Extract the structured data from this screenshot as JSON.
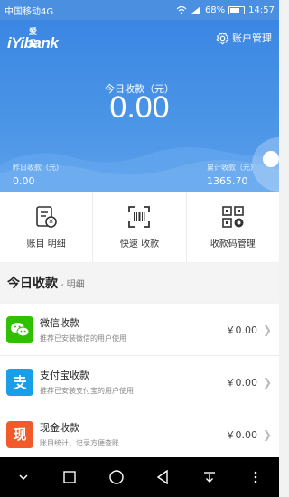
{
  "status": {
    "carrier": "中国移动4G",
    "battery": "68%",
    "time": "14:57"
  },
  "header": {
    "logo_cn": "爱品",
    "logo_en": "iYibank",
    "account_mgmt": "账户管理",
    "today_label": "今日收款（元）",
    "today_amount": "0.00",
    "yesterday_label": "昨日收款（元）",
    "yesterday_amount": "0.00",
    "total_label": "累计收款（元）",
    "total_amount": "1365.70"
  },
  "actions": [
    {
      "label": "账目 明细",
      "icon": "ledger-icon"
    },
    {
      "label": "快速 收款",
      "icon": "scan-icon"
    },
    {
      "label": "收款码管理",
      "icon": "qrcode-icon"
    }
  ],
  "section": {
    "title": "今日收款",
    "sub": "- 明细"
  },
  "payments": [
    {
      "title": "微信收款",
      "desc": "推荐已安装微信的用户使用",
      "amount": "￥0.00",
      "color": "#2dc100",
      "icon": "wechat-icon"
    },
    {
      "title": "支付宝收款",
      "desc": "推荐已安装支付宝的用户使用",
      "amount": "￥0.00",
      "color": "#1a9ee8",
      "icon": "alipay-icon"
    },
    {
      "title": "现金收款",
      "desc": "账目统计、记录方便查账",
      "amount": "￥0.00",
      "color": "#f25a2b",
      "icon": "cash-icon",
      "glyph": "现"
    }
  ],
  "colors": {
    "header": "#3b86e3",
    "navbar": "#000000"
  }
}
